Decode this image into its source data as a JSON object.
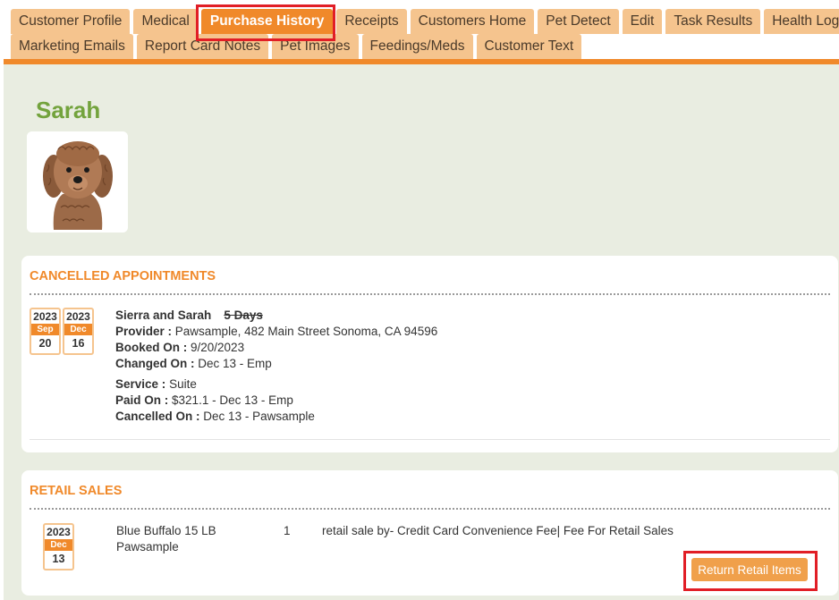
{
  "tabs": {
    "row1": [
      "Customer Profile",
      "Medical",
      "Purchase History",
      "Receipts",
      "Customers Home",
      "Pet Detect",
      "Edit",
      "Task Results",
      "Health Log"
    ],
    "row2": [
      "Marketing Emails",
      "Report Card Notes",
      "Pet Images",
      "Feedings/Meds",
      "Customer Text"
    ],
    "active": "Purchase History"
  },
  "pet": {
    "name": "Sarah",
    "photo_icon": "dog-photo-icon"
  },
  "cancelled": {
    "title": "CANCELLED APPOINTMENTS",
    "start": {
      "year": "2023",
      "month": "Sep",
      "day": "20"
    },
    "end": {
      "year": "2023",
      "month": "Dec",
      "day": "16"
    },
    "pets": "Sierra and Sarah",
    "duration": "5 Days",
    "provider_label": "Provider :",
    "provider": "Pawsample, 482 Main Street Sonoma, CA 94596",
    "booked_label": "Booked On :",
    "booked": "9/20/2023",
    "changed_label": "Changed On :",
    "changed": "Dec 13 - Emp",
    "service_label": "Service :",
    "service": "Suite",
    "paid_label": "Paid On :",
    "paid": "$321.1 - Dec 13 - Emp",
    "cancelled_label": "Cancelled On :",
    "cancelled": "Dec 13 - Pawsample"
  },
  "retail": {
    "title": "RETAIL SALES",
    "date": {
      "year": "2023",
      "month": "Dec",
      "day": "13"
    },
    "item_line1": "Blue Buffalo 15 LB",
    "item_line2": "Pawsample",
    "quantity": "1",
    "note": "retail sale by- Credit Card Convenience Fee| Fee For Retail Sales",
    "return_label": "Return Retail Items"
  },
  "colors": {
    "accent": "#f0892a",
    "tab": "#f5c48e",
    "name_green": "#73a33d",
    "highlight": "#e11e26"
  }
}
